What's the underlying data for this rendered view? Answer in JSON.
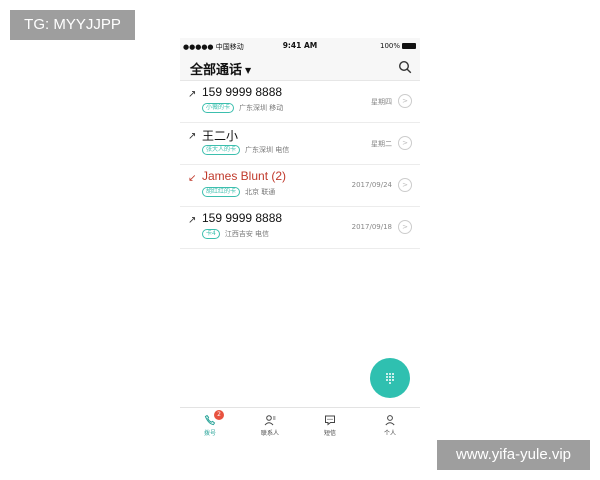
{
  "watermarks": {
    "top_left": "TG: MYYJJPP",
    "bottom_right": "www.yifa-yule.vip"
  },
  "status_bar": {
    "carrier": "●●●●● 中国移动",
    "time": "9:41 AM",
    "battery": "100%"
  },
  "header": {
    "title": "全部通话"
  },
  "calls": [
    {
      "name": "159 9999 8888",
      "tag": "小薇的卡",
      "location": "广东深圳 移动",
      "date": "星期四",
      "missed": false
    },
    {
      "name": "王二小",
      "tag": "张大人的卡",
      "location": "广东深圳 电信",
      "date": "星期二",
      "missed": false
    },
    {
      "name": "James Blunt (2)",
      "tag": "胡红红的卡",
      "location": "北京 联通",
      "date": "2017/09/24",
      "missed": true
    },
    {
      "name": "159 9999 8888",
      "tag": "卡4",
      "location": "江西吉安 电信",
      "date": "2017/09/18",
      "missed": false
    }
  ],
  "tabs": [
    {
      "label": "拨号",
      "badge": "2",
      "active": true
    },
    {
      "label": "联系人"
    },
    {
      "label": "短信"
    },
    {
      "label": "个人"
    }
  ],
  "colors": {
    "accent": "#2fc0b0",
    "missed": "#c0392b",
    "badge": "#e8523f"
  }
}
